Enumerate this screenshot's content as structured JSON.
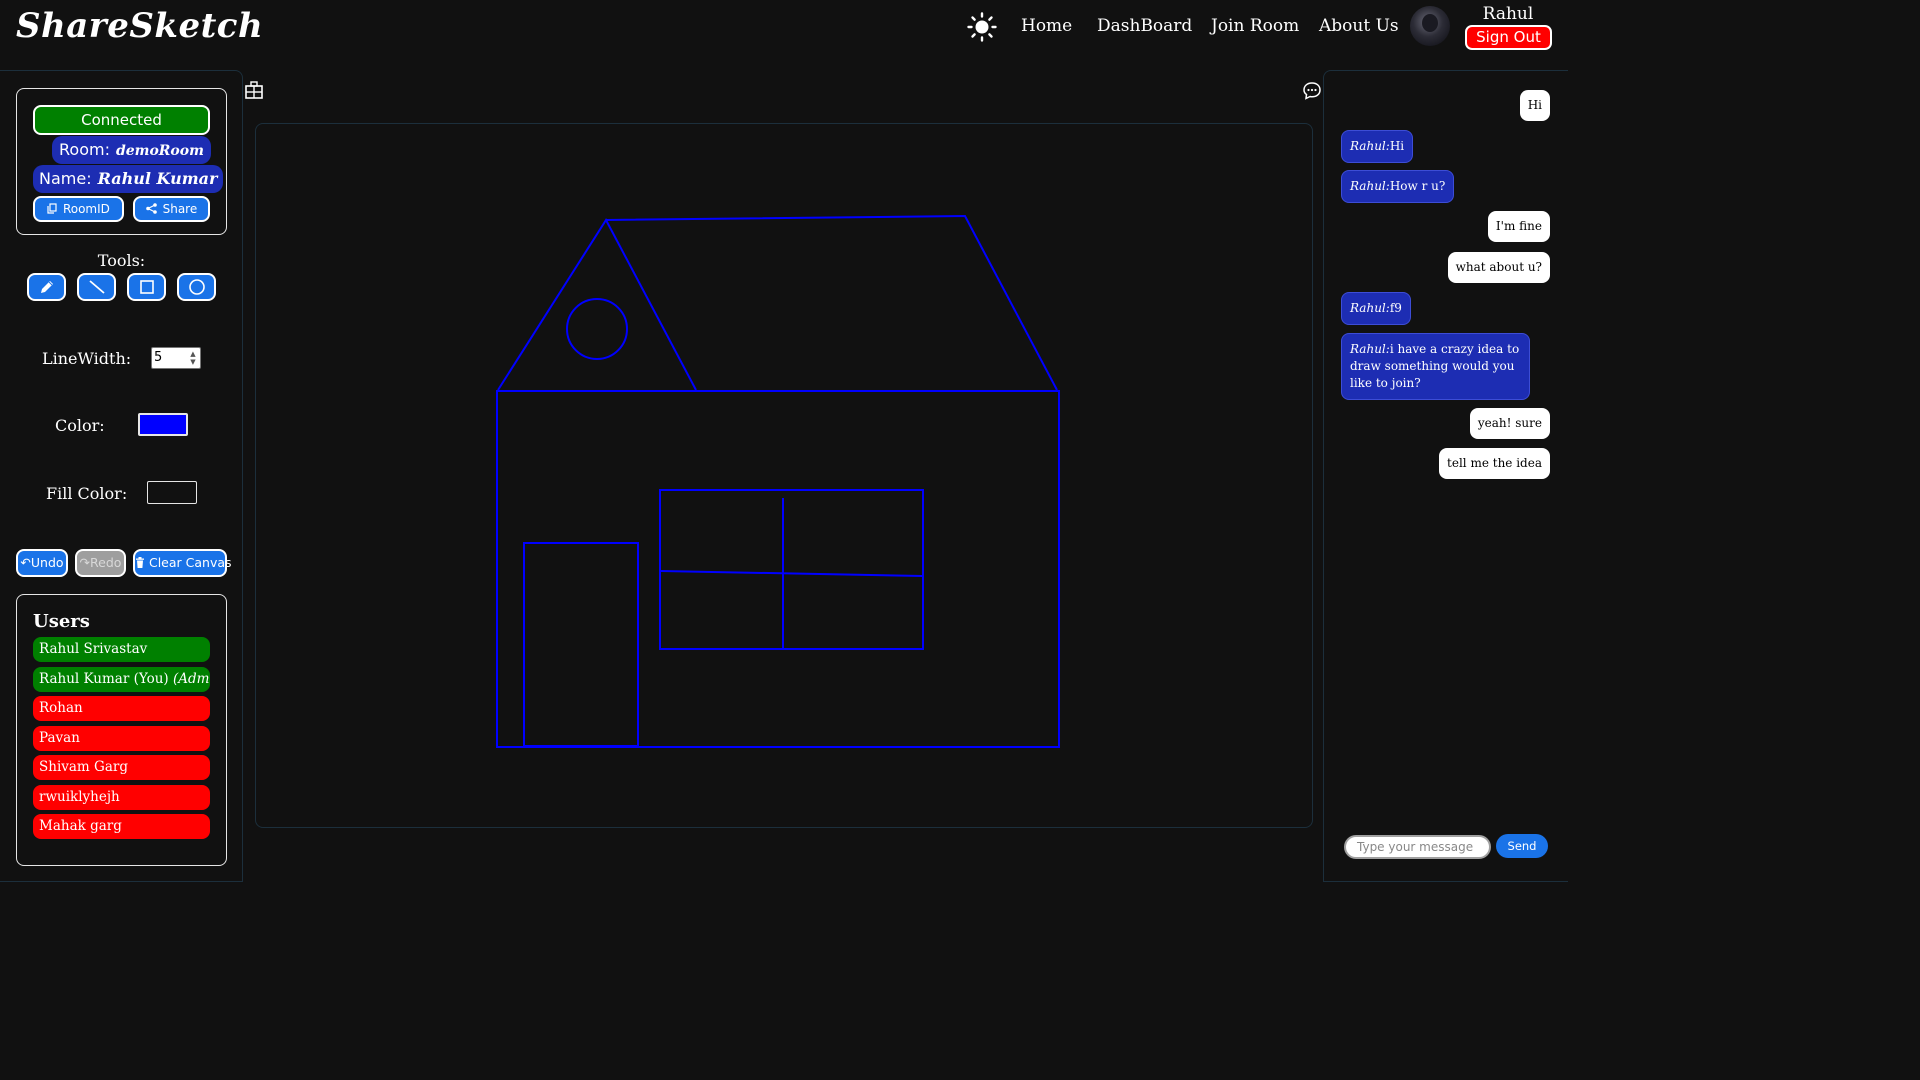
{
  "header": {
    "logo": "ShareSketch",
    "nav": [
      "Home",
      "DashBoard",
      "Join Room",
      "About Us"
    ],
    "user_name": "Rahul",
    "signout_label": "Sign Out",
    "theme_icon": "sun-icon"
  },
  "room": {
    "status": "Connected",
    "room_label": "Room:",
    "room_value": "demoRoom",
    "name_label": "Name:",
    "name_value": "Rahul Kumar",
    "roomid_label": "RoomID",
    "share_label": "Share"
  },
  "tools": {
    "label": "Tools:",
    "items": [
      "pencil-icon",
      "line-icon",
      "rectangle-icon",
      "circle-icon"
    ],
    "linewidth_label": "LineWidth:",
    "linewidth_value": "5",
    "color_label": "Color:",
    "color_value": "#0000ff",
    "fill_label": "Fill Color:"
  },
  "actions": {
    "undo": "Undo",
    "redo": "Redo",
    "clear": "Clear Canvas"
  },
  "users": {
    "title": "Users",
    "list": [
      {
        "name": "Rahul Srivastav",
        "status": "online"
      },
      {
        "name": "Rahul Kumar (You) ",
        "admin": "(Admin)",
        "status": "online"
      },
      {
        "name": "Rohan",
        "status": "offline"
      },
      {
        "name": "Pavan",
        "status": "offline"
      },
      {
        "name": "Shivam Garg",
        "status": "offline"
      },
      {
        "name": "rwuiklyhejh",
        "status": "offline"
      },
      {
        "name": "Mahak garg",
        "status": "offline"
      }
    ]
  },
  "colors": {
    "online": "#008000",
    "offline": "#ff0000",
    "accent": "#1a73e8",
    "pill": "#1d2db3",
    "stroke": "#0000ff"
  },
  "chat": {
    "messages": [
      {
        "mine": true,
        "text": "Hi"
      },
      {
        "mine": false,
        "who": "Rahul:",
        "text": "Hi"
      },
      {
        "mine": false,
        "who": "Rahul:",
        "text": "How r u?"
      },
      {
        "mine": true,
        "text": "I'm fine"
      },
      {
        "mine": true,
        "text": "what about u?"
      },
      {
        "mine": false,
        "who": "Rahul:",
        "text": "f9"
      },
      {
        "mine": false,
        "who": "Rahul:",
        "text": "i have a crazy idea to draw something would you like to join?"
      },
      {
        "mine": true,
        "text": "yeah! sure"
      },
      {
        "mine": true,
        "text": "tell me the idea"
      }
    ],
    "placeholder": "Type your message",
    "send_label": "Send"
  }
}
